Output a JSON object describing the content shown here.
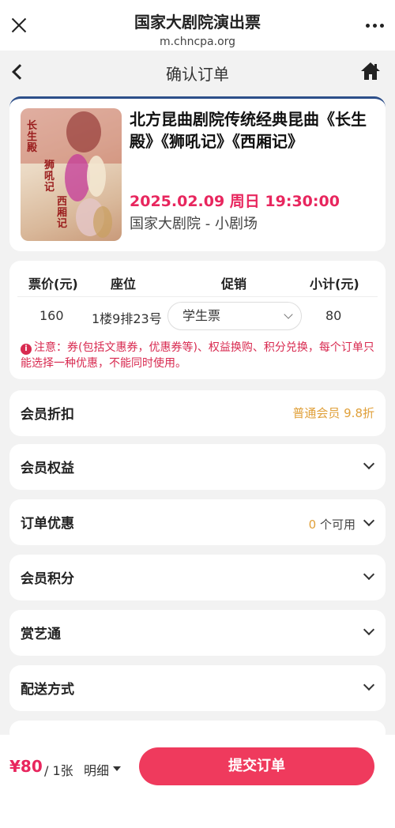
{
  "browser": {
    "title": "国家大剧院演出票",
    "url": "m.chncpa.org"
  },
  "nav": {
    "title": "确认订单"
  },
  "show": {
    "name": "北方昆曲剧院传统经典昆曲《长生殿》《狮吼记》《西厢记》",
    "datetime": "2025.02.09 周日 19:30:00",
    "venue": "国家大剧院 - 小剧场",
    "poster_text": [
      "长生殿",
      "狮吼记",
      "西厢记"
    ]
  },
  "ticket": {
    "headers": [
      "票价(元)",
      "座位",
      "促销",
      "小计(元)"
    ],
    "price": "160",
    "seat": "1楼9排23号",
    "promo": "学生票",
    "subtotal": "80",
    "notice": "注意：券(包括文惠券，优惠券等)、权益换购、积分兑换，每个订单只能选择一种优惠，不能同时使用。"
  },
  "sections": {
    "member_discount": {
      "label": "会员折扣",
      "value": "普通会员 9.8折"
    },
    "member_rights": {
      "label": "会员权益"
    },
    "order_discount": {
      "label": "订单优惠",
      "count": "0",
      "suffix": " 个可用"
    },
    "member_points": {
      "label": "会员积分"
    },
    "shangyitong": {
      "label": "赏艺通"
    },
    "delivery": {
      "label": "配送方式"
    }
  },
  "footer": {
    "total": "¥80",
    "per": "/ 1张",
    "detail": "明细",
    "submit": "提交订单"
  },
  "colors": {
    "accent": "#ef3a5d",
    "price": "#e8265e",
    "gold": "#e0a03a",
    "notice": "#d82a50"
  }
}
